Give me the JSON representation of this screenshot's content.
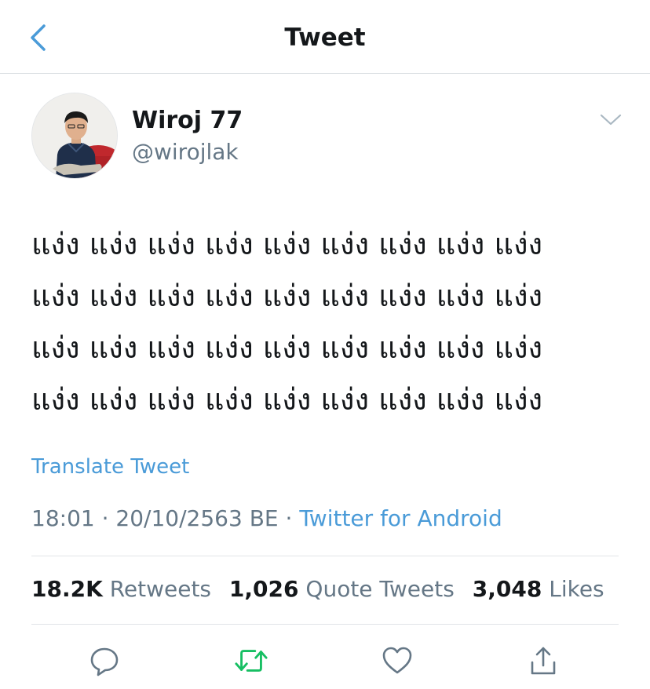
{
  "header": {
    "title": "Tweet",
    "back_icon": "chevron-left-icon"
  },
  "author": {
    "display_name": "Wiroj 77",
    "handle": "@wirojlak",
    "avatar_icon": "profile-photo",
    "menu_icon": "chevron-down-icon"
  },
  "tweet": {
    "text": "แง่ง แง่ง แง่ง แง่ง แง่ง แง่ง แง่ง แง่ง แง่ง\nแง่ง แง่ง แง่ง แง่ง แง่ง แง่ง แง่ง แง่ง แง่ง\nแง่ง แง่ง แง่ง แง่ง แง่ง แง่ง แง่ง แง่ง แง่ง\nแง่ง แง่ง แง่ง แง่ง แง่ง แง่ง แง่ง แง่ง แง่ง",
    "translate_label": "Translate Tweet",
    "time": "18:01",
    "date": "20/10/2563 BE",
    "separator": "·",
    "source": "Twitter for Android"
  },
  "stats": {
    "retweets_count": "18.2K",
    "retweets_label": "Retweets",
    "quotes_count": "1,026",
    "quotes_label": "Quote Tweets",
    "likes_count": "3,048",
    "likes_label": "Likes"
  },
  "actions": {
    "reply_icon": "reply-icon",
    "retweet_icon": "retweet-icon",
    "like_icon": "heart-icon",
    "share_icon": "share-icon"
  },
  "colors": {
    "accent": "#4a9bd8",
    "retweet_green": "#17bf63",
    "secondary_text": "#657786",
    "primary_text": "#14171a",
    "divider": "#e1e4e8"
  }
}
